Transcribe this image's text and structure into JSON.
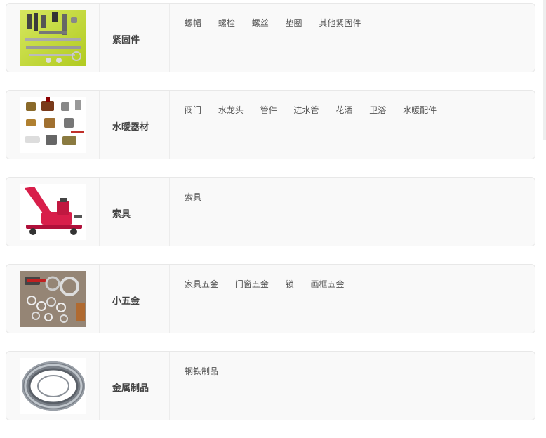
{
  "categories": [
    {
      "title": "紧固件",
      "image_icon": "fasteners-photo",
      "links": [
        "螺帽",
        "螺栓",
        "螺丝",
        "垫圈",
        "其他紧固件"
      ]
    },
    {
      "title": "水暖器材",
      "image_icon": "plumbing-valves-photo",
      "links": [
        "阀门",
        "水龙头",
        "管件",
        "进水管",
        "花洒",
        "卫浴",
        "水暖配件"
      ]
    },
    {
      "title": "索具",
      "image_icon": "hydraulic-jack-photo",
      "links": [
        "索具"
      ]
    },
    {
      "title": "小五金",
      "image_icon": "small-hardware-photo",
      "links": [
        "家具五金",
        "门窗五金",
        "锁",
        "画框五金"
      ]
    },
    {
      "title": "金属制品",
      "image_icon": "wire-coil-photo",
      "links": [
        "钢铁制品"
      ]
    }
  ]
}
